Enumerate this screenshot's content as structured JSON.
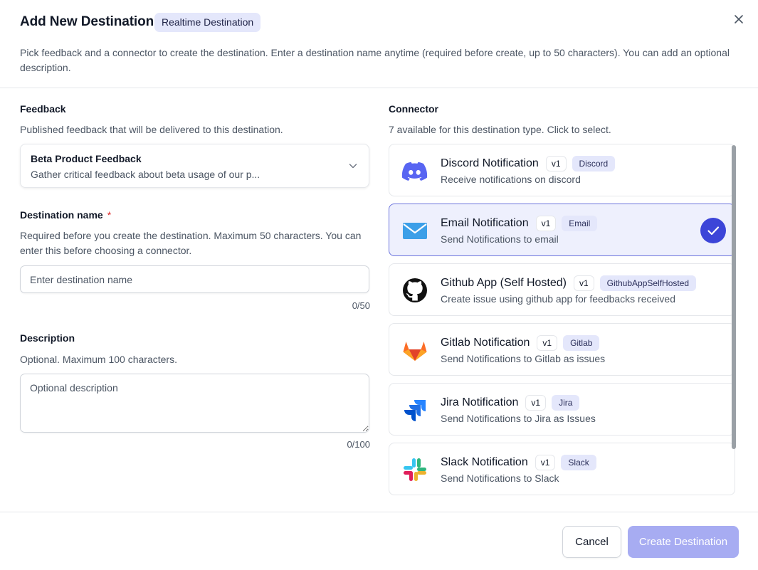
{
  "dialog": {
    "title": "Add New Destination",
    "type_badge": "Realtime Destination",
    "description": "Pick feedback and a connector to create the destination. Enter a destination name anytime (required before create, up to 50 characters). You can add an optional description."
  },
  "feedback": {
    "label": "Feedback",
    "help": "Published feedback that will be delivered to this destination.",
    "selected_name": "Beta Product Feedback",
    "selected_description": "Gather critical feedback about beta usage of our p..."
  },
  "destination_name": {
    "label": "Destination name",
    "required_mark": "*",
    "help": "Required before you create the destination. Maximum 50 characters. You can enter this before choosing a connector.",
    "value": "",
    "placeholder": "Enter destination name",
    "counter": "0/50"
  },
  "description_field": {
    "label": "Description",
    "help": "Optional. Maximum 100 characters.",
    "value": "",
    "placeholder": "Optional description",
    "counter": "0/100"
  },
  "connector": {
    "label": "Connector",
    "help": "7 available for this destination type. Click to select.",
    "items": [
      {
        "name": "Discord Notification",
        "version": "v1",
        "tag": "Discord",
        "description": "Receive notifications on discord",
        "icon": "discord-icon",
        "selected": false
      },
      {
        "name": "Email Notification",
        "version": "v1",
        "tag": "Email",
        "description": "Send Notifications to email",
        "icon": "envelope-icon",
        "selected": true
      },
      {
        "name": "Github App (Self Hosted)",
        "version": "v1",
        "tag": "GithubAppSelfHosted",
        "description": "Create issue using github app for feedbacks received",
        "icon": "github-icon",
        "selected": false
      },
      {
        "name": "Gitlab Notification",
        "version": "v1",
        "tag": "Gitlab",
        "description": "Send Notifications to Gitlab as issues",
        "icon": "gitlab-icon",
        "selected": false
      },
      {
        "name": "Jira Notification",
        "version": "v1",
        "tag": "Jira",
        "description": "Send Notifications to Jira as Issues",
        "icon": "jira-icon",
        "selected": false
      },
      {
        "name": "Slack Notification",
        "version": "v1",
        "tag": "Slack",
        "description": "Send Notifications to Slack",
        "icon": "slack-icon",
        "selected": false
      }
    ]
  },
  "footer": {
    "cancel_label": "Cancel",
    "create_label": "Create Destination"
  },
  "colors": {
    "accent": "#3c45d8",
    "badge_bg": "#e4e7fb",
    "selected_card_bg": "#eef0fd",
    "create_disabled_bg": "#a7acf2",
    "required": "#dc2626"
  }
}
